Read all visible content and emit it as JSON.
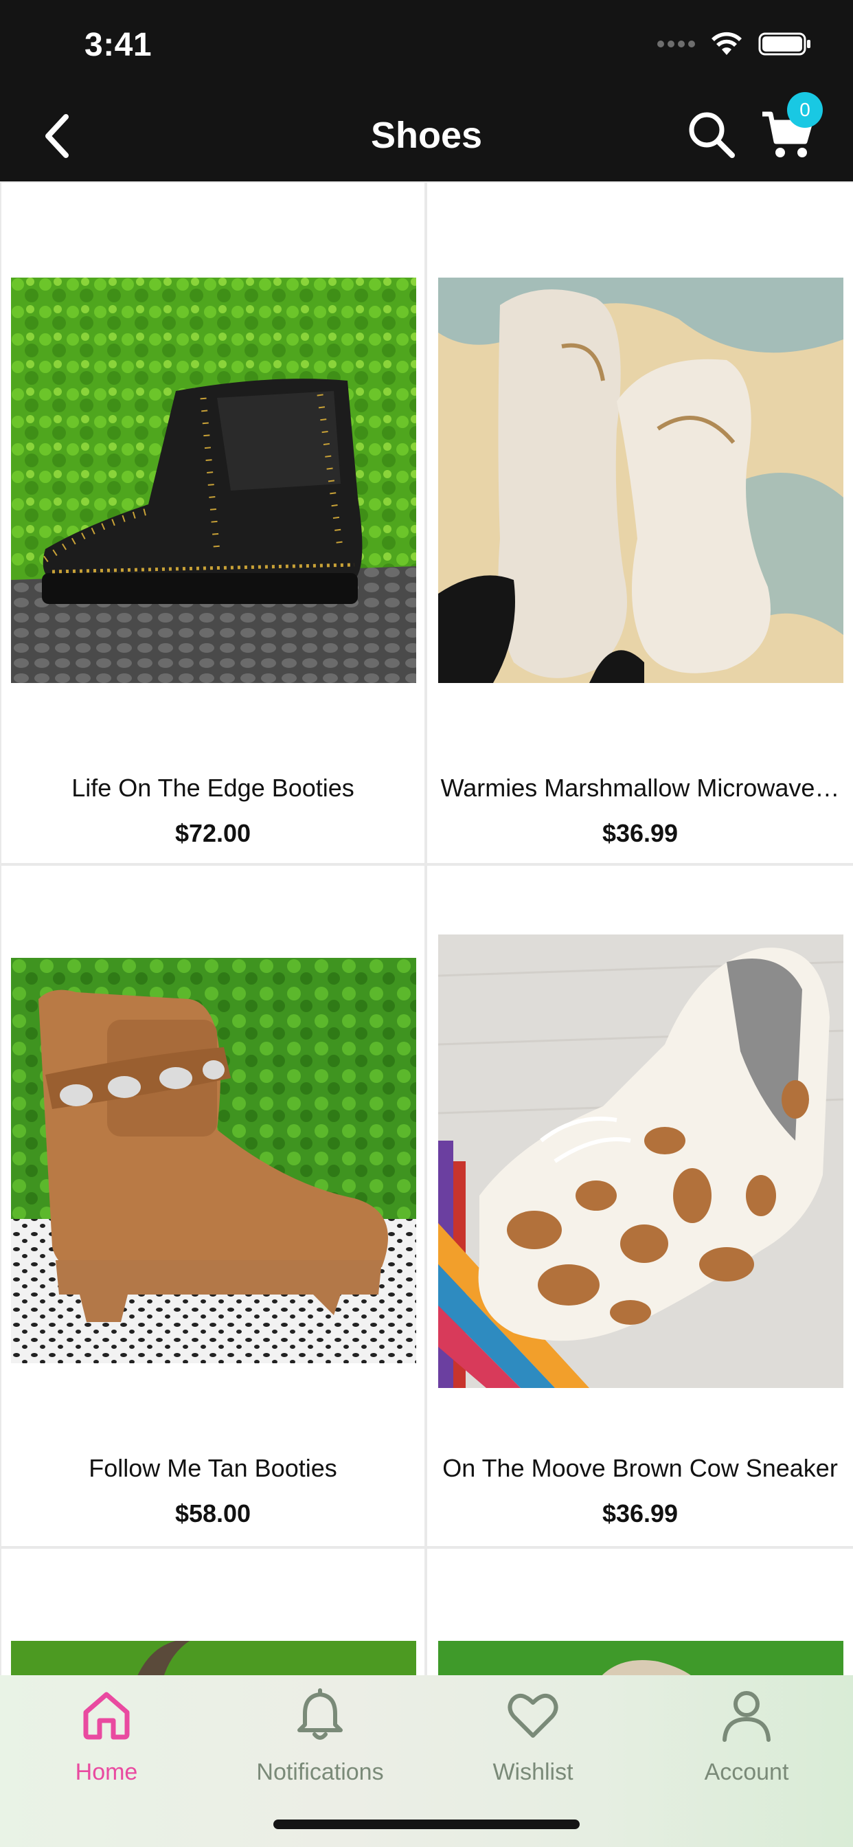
{
  "status_bar": {
    "time": "3:41"
  },
  "nav": {
    "title": "Shoes",
    "cart_count": "0"
  },
  "products": [
    {
      "name": "Life On The Edge Booties",
      "price": "$72.00"
    },
    {
      "name": "Warmies Marshmallow Microwave…",
      "price": "$36.99"
    },
    {
      "name": "Follow Me Tan Booties",
      "price": "$58.00"
    },
    {
      "name": "On The Moove Brown Cow Sneaker",
      "price": "$36.99"
    }
  ],
  "tabs": [
    {
      "label": "Home",
      "icon": "home-icon",
      "active": true
    },
    {
      "label": "Notifications",
      "icon": "bell-icon",
      "active": false
    },
    {
      "label": "Wishlist",
      "icon": "heart-icon",
      "active": false
    },
    {
      "label": "Account",
      "icon": "person-icon",
      "active": false
    }
  ],
  "colors": {
    "accent": "#e94aa0",
    "badge": "#19c8e3",
    "bar": "#141414",
    "tab_inactive": "#7a8a78"
  }
}
